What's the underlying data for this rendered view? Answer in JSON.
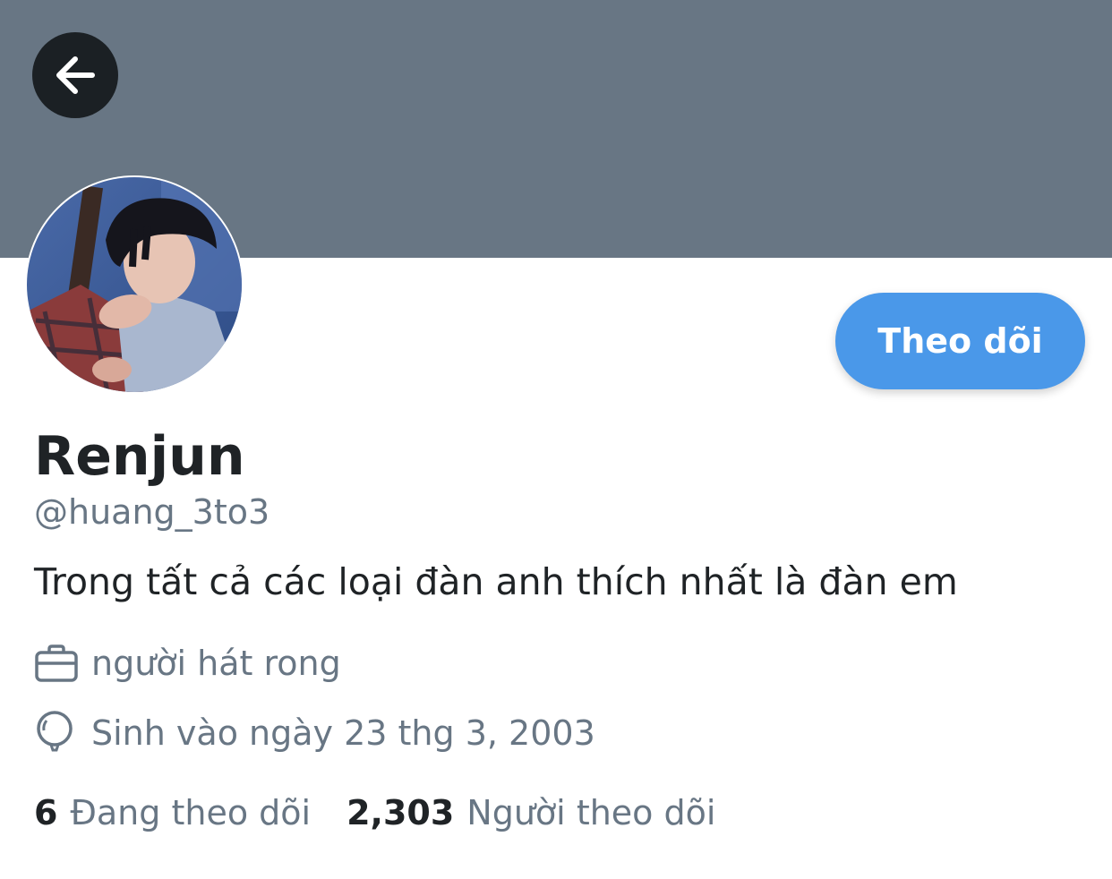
{
  "header": {
    "back_icon": "arrow-left-icon",
    "banner_color": "#687684"
  },
  "profile": {
    "avatar": "profile-photo",
    "follow_label": "Theo dõi",
    "display_name": "Renjun",
    "handle": "@huang_3to3",
    "bio": "Trong tất cả các loại đàn anh thích nhất là đàn em",
    "job_icon": "briefcase-icon",
    "job": "người hát rong",
    "birth_icon": "balloon-icon",
    "birthday": "Sinh vào ngày 23 thg 3, 2003"
  },
  "stats": {
    "following_count": "6",
    "following_label": "Đang theo dõi",
    "followers_count": "2,303",
    "followers_label": "Người theo dõi"
  },
  "colors": {
    "accent": "#4a98e9",
    "secondary_text": "#687684",
    "primary_text": "#1f2326"
  }
}
